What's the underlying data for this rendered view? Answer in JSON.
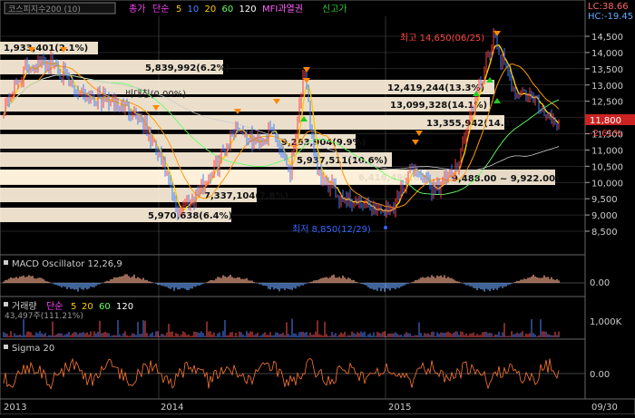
{
  "header": {
    "title_box": "코스피지수200 (10)",
    "legend": [
      {
        "text": "종가",
        "color": "#ff44ff"
      },
      {
        "text": "단순",
        "color": "#ff44ff"
      },
      {
        "text": "5",
        "color": "#ffcc00"
      },
      {
        "text": "10",
        "color": "#4488ff"
      },
      {
        "text": "20",
        "color": "#ffcc00"
      },
      {
        "text": "60",
        "color": "#66ff66"
      },
      {
        "text": "120",
        "color": "#ffffff"
      },
      {
        "text": "MFI과열권",
        "color": "#ff66ff"
      },
      {
        "text": "신고가",
        "color": "#33cc33"
      }
    ],
    "right_top": {
      "lc": "LC:38.66",
      "hc": "HC:-19.45"
    }
  },
  "price_axis": {
    "labels": [
      "14,500",
      "14,000",
      "13,500",
      "13,000",
      "12,500",
      "12,000",
      "11,500",
      "11,000",
      "10,500",
      "10,000",
      "9,500",
      "9,000",
      "8,500"
    ],
    "current_value": "11,800",
    "change": "-2.61%"
  },
  "price_boxes": [
    {
      "text": "1,933,401(2.1%)"
    },
    {
      "text": "5,839,992(6.2%)"
    },
    {
      "text": "12,419,244(13.3%)"
    },
    {
      "text": "13,099,328(14.1%)"
    },
    {
      "text": "13,355,942(14.3%)"
    },
    {
      "text": "9,263,904(9.9%)"
    },
    {
      "text": "5,937,511(10.6%)"
    },
    {
      "text": "6,416,490(6.4%)"
    },
    {
      "text": "9,488.00 ~ 9,922.00)"
    },
    {
      "text": "7,337,104(7.8%)"
    },
    {
      "text": "5,970,638(6.4%)"
    }
  ],
  "annotations": {
    "high": "최고 14,650(06/25)",
    "low": "최저 8,850(12/29)",
    "midline": "비대칭(0.00%)"
  },
  "macd": {
    "title": "MACD Oscillator 12,26,9",
    "zero_label": "0.00"
  },
  "volume": {
    "title": "거래량 단순 5 20 60 120",
    "sub": "43,497주(111.21%)",
    "axis_label": "1,000K"
  },
  "sigma": {
    "title": "Sigma 20",
    "zero_label": "0.00"
  },
  "date_axis": {
    "labels": [
      "2013",
      "2014",
      "2015"
    ],
    "right": "09/30"
  },
  "colors": {
    "candle_up": "#ff4040",
    "candle_down": "#4080ff",
    "box_fill": "#fff2dc",
    "grid": "#444444"
  }
}
